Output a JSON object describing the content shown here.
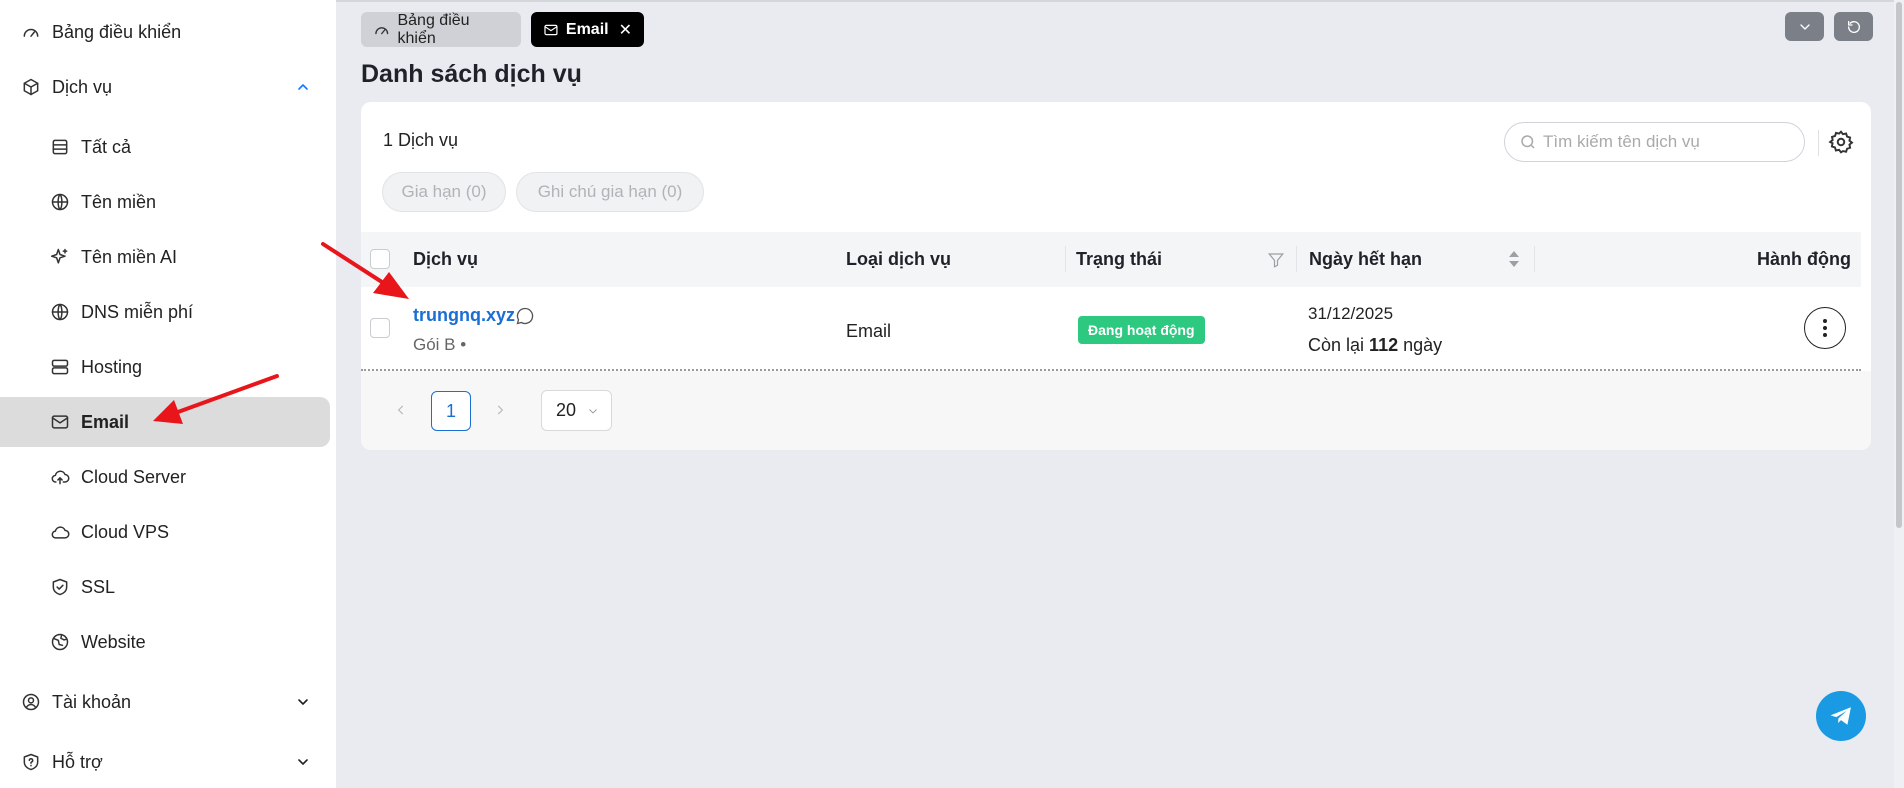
{
  "sidebar": {
    "dashboard": "Bảng điều khiển",
    "services": "Dịch vụ",
    "sub_items": [
      {
        "label": "Tất cả",
        "icon": "database-icon"
      },
      {
        "label": "Tên miền",
        "icon": "globe-icon"
      },
      {
        "label": "Tên miền AI",
        "icon": "sparkle-icon"
      },
      {
        "label": "DNS miễn phí",
        "icon": "globe-icon"
      },
      {
        "label": "Hosting",
        "icon": "server-icon"
      },
      {
        "label": "Email",
        "icon": "mail-icon",
        "active": true
      },
      {
        "label": "Cloud Server",
        "icon": "cloud-upload-icon"
      },
      {
        "label": "Cloud VPS",
        "icon": "cloud-icon"
      },
      {
        "label": "SSL",
        "icon": "shield-check-icon"
      },
      {
        "label": "Website",
        "icon": "website-icon"
      }
    ],
    "account": "Tài khoản",
    "support": "Hỗ trợ"
  },
  "tabs": {
    "dashboard": "Bảng điều khiển",
    "email": "Email",
    "close": "✕"
  },
  "page": {
    "title": "Danh sách dịch vụ"
  },
  "list": {
    "count": "1 Dịch vụ",
    "search_placeholder": "Tìm kiếm tên dịch vụ",
    "filter_renew": "Gia hạn (0)",
    "filter_renew_note": "Ghi chú gia hạn (0)",
    "columns": {
      "service": "Dịch vụ",
      "type": "Loại dịch vụ",
      "status": "Trạng thái",
      "expiry": "Ngày hết hạn",
      "actions": "Hành động"
    },
    "rows": [
      {
        "name": "trungnq.xyz",
        "plan": "Gói B  •",
        "type": "Email",
        "status": "Đang hoạt động",
        "expiry_date": "31/12/2025",
        "remain_prefix": "Còn lại",
        "remain_days": "112",
        "remain_suffix": "ngày"
      }
    ]
  },
  "pagination": {
    "current": "1",
    "page_size": "20"
  },
  "colors": {
    "accent": "#1a6ed4",
    "status_active": "#2ec980",
    "annotation": "#e8161b",
    "telegram": "#1a9ae3"
  }
}
